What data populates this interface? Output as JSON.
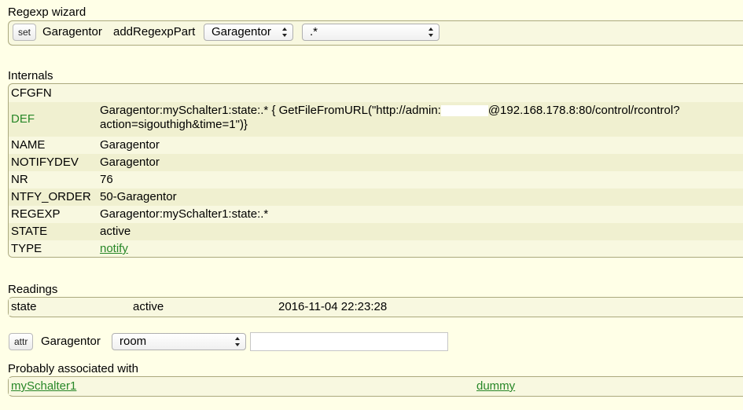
{
  "regexp_wizard": {
    "title": "Regexp wizard",
    "set_button": "set",
    "device_name": "Garagentor",
    "command": "addRegexpPart",
    "device_select": "Garagentor",
    "pattern_select": ".*"
  },
  "internals": {
    "title": "Internals",
    "rows": [
      {
        "key": "CFGFN",
        "value": ""
      },
      {
        "key": "DEF",
        "value_line1": "Garagentor:mySchalter1:state:.* { GetFileFromURL(\"http://admin:",
        "value_redacted_suffix": "@192.168.178.8:80/control/rcontrol?",
        "value_line2": "action=sigouthigh&time=1\")}"
      },
      {
        "key": "NAME",
        "value": "Garagentor"
      },
      {
        "key": "NOTIFYDEV",
        "value": "Garagentor"
      },
      {
        "key": "NR",
        "value": "76"
      },
      {
        "key": "NTFY_ORDER",
        "value": "50-Garagentor"
      },
      {
        "key": "REGEXP",
        "value": "Garagentor:mySchalter1:state:.*"
      },
      {
        "key": "STATE",
        "value": "active"
      },
      {
        "key": "TYPE",
        "value": "notify"
      }
    ]
  },
  "readings": {
    "title": "Readings",
    "rows": [
      {
        "name": "state",
        "value": "active",
        "timestamp": "2016-11-04 22:23:28"
      }
    ]
  },
  "attr": {
    "button": "attr",
    "device_name": "Garagentor",
    "attribute_select": "room",
    "value_input": ""
  },
  "associated": {
    "title": "Probably associated with",
    "items": [
      {
        "name": "mySchalter1",
        "type": "dummy"
      }
    ]
  },
  "colors": {
    "page_bg": "#FFFFE7",
    "block_bg": "#F8F8E0",
    "row_alt_bg": "#F0F0D0",
    "border": "#ABA97E",
    "link": "#278727"
  }
}
